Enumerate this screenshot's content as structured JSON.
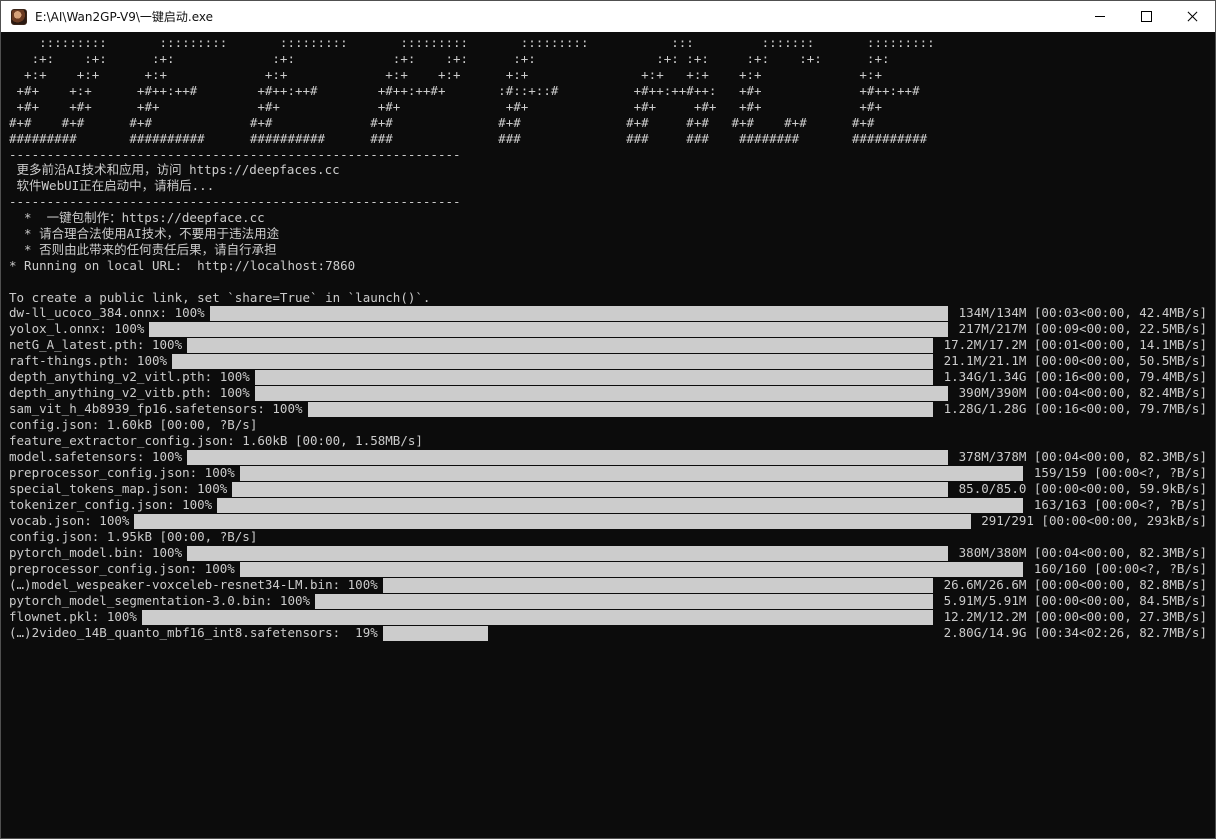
{
  "window": {
    "title": "E:\\AI\\Wan2GP-V9\\一键启动.exe"
  },
  "icons": {
    "app": "app-icon",
    "minimize": "minimize-icon",
    "maximize": "maximize-icon",
    "close": "close-icon"
  },
  "console": {
    "ascii_art": [
      "    :::::::::       :::::::::       :::::::::       :::::::::       :::::::::           :::         :::::::       :::::::::",
      "   :+:    :+:      :+:             :+:             :+:    :+:      :+:                :+: :+:     :+:    :+:      :+:",
      "  +:+    +:+      +:+             +:+             +:+    +:+      +:+               +:+   +:+    +:+             +:+",
      " +#+    +:+      +#++:++#        +#++:++#        +#++:++#+       :#::+::#          +#++:++#++:   +#+             +#++:++#",
      " +#+    +#+      +#+             +#+             +#+              +#+              +#+     +#+   +#+             +#+",
      "#+#    #+#      #+#             #+#             #+#              #+#              #+#     #+#   #+#    #+#      #+#",
      "#########       ##########      ##########      ###              ###              ###     ###    ########       ##########"
    ],
    "divider_1": "------------------------------------------------------------",
    "info_line_1": " 更多前沿AI技术和应用，访问 https://deepfaces.cc",
    "info_line_2": " 软件WebUI正在启动中，请稍后...",
    "divider_2": "------------------------------------------------------------",
    "notes": [
      "  *  一键包制作：https://deepface.cc",
      "  * 请合理合法使用AI技术，不要用于违法用途",
      "  * 否则由此带来的任何责任后果，请自行承担"
    ],
    "running_line": "* Running on local URL:  http://localhost:7860",
    "public_link_line": "To create a public link, set `share=True` in `launch()`.",
    "lines": [
      {
        "type": "bar",
        "label": "dw-ll_ucoco_384.onnx: 100%",
        "progress": 1.0,
        "stat": " 134M/134M [00:03<00:00, 42.4MB/s]"
      },
      {
        "type": "bar",
        "label": "yolox_l.onnx: 100%",
        "progress": 1.0,
        "stat": " 217M/217M [00:09<00:00, 22.5MB/s]"
      },
      {
        "type": "bar",
        "label": "netG_A_latest.pth: 100%",
        "progress": 1.0,
        "stat": " 17.2M/17.2M [00:01<00:00, 14.1MB/s]"
      },
      {
        "type": "bar",
        "label": "raft-things.pth: 100%",
        "progress": 1.0,
        "stat": " 21.1M/21.1M [00:00<00:00, 50.5MB/s]"
      },
      {
        "type": "bar",
        "label": "depth_anything_v2_vitl.pth: 100%",
        "progress": 1.0,
        "stat": " 1.34G/1.34G [00:16<00:00, 79.4MB/s]"
      },
      {
        "type": "bar",
        "label": "depth_anything_v2_vitb.pth: 100%",
        "progress": 1.0,
        "stat": " 390M/390M [00:04<00:00, 82.4MB/s]"
      },
      {
        "type": "bar",
        "label": "sam_vit_h_4b8939_fp16.safetensors: 100%",
        "progress": 1.0,
        "stat": " 1.28G/1.28G [00:16<00:00, 79.7MB/s]"
      },
      {
        "type": "text",
        "text": "config.json: 1.60kB [00:00, ?B/s]"
      },
      {
        "type": "text",
        "text": "feature_extractor_config.json: 1.60kB [00:00, 1.58MB/s]"
      },
      {
        "type": "bar",
        "label": "model.safetensors: 100%",
        "progress": 1.0,
        "stat": " 378M/378M [00:04<00:00, 82.3MB/s]"
      },
      {
        "type": "bar",
        "label": "preprocessor_config.json: 100%",
        "progress": 1.0,
        "stat": " 159/159 [00:00<?, ?B/s]"
      },
      {
        "type": "bar",
        "label": "special_tokens_map.json: 100%",
        "progress": 1.0,
        "stat": " 85.0/85.0 [00:00<00:00, 59.9kB/s]"
      },
      {
        "type": "bar",
        "label": "tokenizer_config.json: 100%",
        "progress": 1.0,
        "stat": " 163/163 [00:00<?, ?B/s]"
      },
      {
        "type": "bar",
        "label": "vocab.json: 100%",
        "progress": 1.0,
        "stat": " 291/291 [00:00<00:00, 293kB/s]"
      },
      {
        "type": "text",
        "text": "config.json: 1.95kB [00:00, ?B/s]"
      },
      {
        "type": "bar",
        "label": "pytorch_model.bin: 100%",
        "progress": 1.0,
        "stat": " 380M/380M [00:04<00:00, 82.3MB/s]"
      },
      {
        "type": "bar",
        "label": "preprocessor_config.json: 100%",
        "progress": 1.0,
        "stat": " 160/160 [00:00<?, ?B/s]"
      },
      {
        "type": "bar",
        "label": "(…)model_wespeaker-voxceleb-resnet34-LM.bin: 100%",
        "progress": 1.0,
        "stat": " 26.6M/26.6M [00:00<00:00, 82.8MB/s]"
      },
      {
        "type": "bar",
        "label": "pytorch_model_segmentation-3.0.bin: 100%",
        "progress": 1.0,
        "stat": " 5.91M/5.91M [00:00<00:00, 84.5MB/s]"
      },
      {
        "type": "bar",
        "label": "flownet.pkl: 100%",
        "progress": 1.0,
        "stat": " 12.2M/12.2M [00:00<00:00, 27.3MB/s]"
      },
      {
        "type": "bar",
        "label": "(…)2video_14B_quanto_mbf16_int8.safetensors:  19%",
        "progress": 0.19,
        "stat": " 2.80G/14.9G [00:34<02:26, 82.7MB/s]"
      }
    ]
  }
}
